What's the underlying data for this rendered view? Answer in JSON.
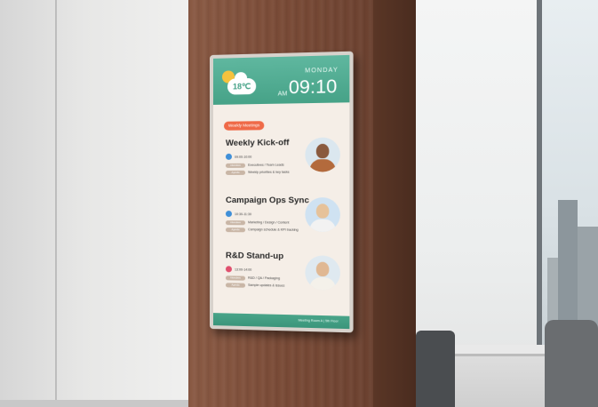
{
  "display": {
    "weather_temperature": "18℃",
    "day": "MONDAY",
    "ampm": "AM",
    "time": "09:10",
    "section_badge": "Weekly Meetings",
    "meetings": [
      {
        "title": "Weekly Kick-off",
        "time": "09:00-10:00",
        "tag1": "Attendees",
        "tag1_value": "Executives / Team Leads",
        "tag2": "Agenda",
        "tag2_value": "Weekly priorities & key tasks",
        "dot_color": "#3f8fd8"
      },
      {
        "title": "Campaign Ops Sync",
        "time": "10:30-11:30",
        "tag1": "Attendees",
        "tag1_value": "Marketing / Design / Content",
        "tag2": "Agenda",
        "tag2_value": "Campaign schedule & KPI tracking",
        "dot_color": "#3f8fd8"
      },
      {
        "title": "R&D Stand-up",
        "time": "13:00-14:00",
        "tag1": "Attendees",
        "tag1_value": "R&D / QA / Packaging",
        "tag2": "Agenda",
        "tag2_value": "Sample updates & issues",
        "dot_color": "#e0506e"
      }
    ],
    "footer": "Meeting Room A | 5th Floor"
  },
  "colors": {
    "header_green": "#46a287",
    "badge_orange": "#ef6a48",
    "screen_background": "#f5eee7",
    "wood": "#7a4b37"
  }
}
